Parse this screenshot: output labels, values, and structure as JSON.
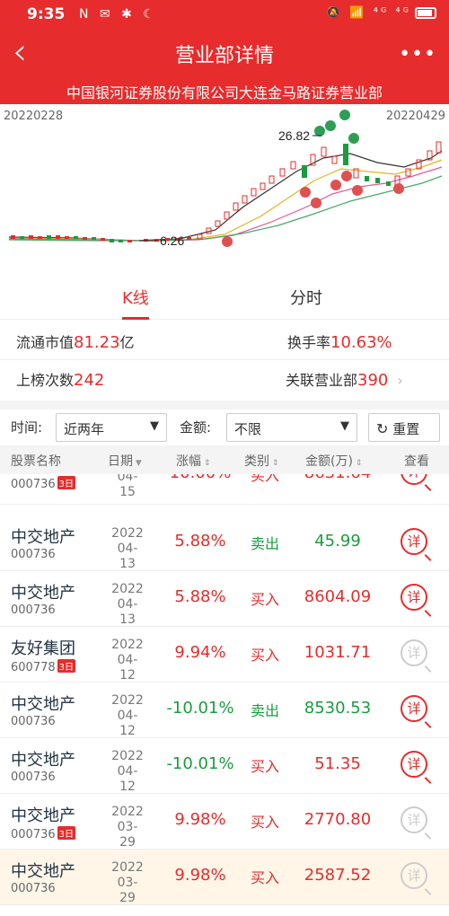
{
  "status": {
    "time": "9:35",
    "left_icons": "N ✉ ✱ ☾",
    "right_icons": "🔕 📶 ⁴ᴳ ⁴ᴳ"
  },
  "header": {
    "back": "‹",
    "title": "营业部详情",
    "more": "•••",
    "subtitle": "中国银河证券股份有限公司大连金马路证券营业部"
  },
  "chart": {
    "start_date": "20220228",
    "end_date": "20220429",
    "high_label": "26.82",
    "low_label": "6.26",
    "buy_marker": "买",
    "sell_marker": "卖"
  },
  "tabs": [
    {
      "label": "K线"
    },
    {
      "label": "分时"
    }
  ],
  "stats": {
    "market_cap_label": "流通市值",
    "market_cap_value": "81.23",
    "market_cap_unit": "亿",
    "turnover_label": "换手率",
    "turnover_value": "10.63%",
    "list_count_label": "上榜次数",
    "list_count_value": "242",
    "related_label": "关联营业部",
    "related_value": "390"
  },
  "filters": {
    "time_label": "时间:",
    "time_value": "近两年",
    "amount_label": "金额:",
    "amount_value": "不限",
    "reset_label": "重置"
  },
  "table": {
    "headers": {
      "name": "股票名称",
      "date": "日期",
      "pct": "涨幅",
      "type": "类别",
      "amount": "金额(万)",
      "view": "查看"
    },
    "rows": [
      {
        "name": "中交地产",
        "code": "000736",
        "tag": "3日",
        "year": "2022",
        "md": "04-15",
        "pct": "10.00%",
        "type": "买入",
        "amount": "8631.64",
        "detail": "详"
      },
      {
        "name": "中交地产",
        "code": "000736",
        "tag": "",
        "year": "2022",
        "md": "04-13",
        "pct": "5.88%",
        "type": "卖出",
        "amount": "45.99",
        "detail": "详"
      },
      {
        "name": "中交地产",
        "code": "000736",
        "tag": "",
        "year": "2022",
        "md": "04-13",
        "pct": "5.88%",
        "type": "买入",
        "amount": "8604.09",
        "detail": "详"
      },
      {
        "name": "友好集团",
        "code": "600778",
        "tag": "3日",
        "year": "2022",
        "md": "04-12",
        "pct": "9.94%",
        "type": "买入",
        "amount": "1031.71",
        "detail": "详"
      },
      {
        "name": "中交地产",
        "code": "000736",
        "tag": "",
        "year": "2022",
        "md": "04-12",
        "pct": "-10.01%",
        "type": "卖出",
        "amount": "8530.53",
        "detail": "详"
      },
      {
        "name": "中交地产",
        "code": "000736",
        "tag": "",
        "year": "2022",
        "md": "04-12",
        "pct": "-10.01%",
        "type": "买入",
        "amount": "51.35",
        "detail": "详"
      },
      {
        "name": "中交地产",
        "code": "000736",
        "tag": "3日",
        "year": "2022",
        "md": "03-29",
        "pct": "9.98%",
        "type": "买入",
        "amount": "2770.80",
        "detail": "详"
      },
      {
        "name": "中交地产",
        "code": "000736",
        "tag": "",
        "year": "2022",
        "md": "03-29",
        "pct": "9.98%",
        "type": "买入",
        "amount": "2587.52",
        "detail": "详"
      }
    ]
  },
  "colors": {
    "brand": "#e62c2c",
    "down": "#1a9c3e"
  }
}
